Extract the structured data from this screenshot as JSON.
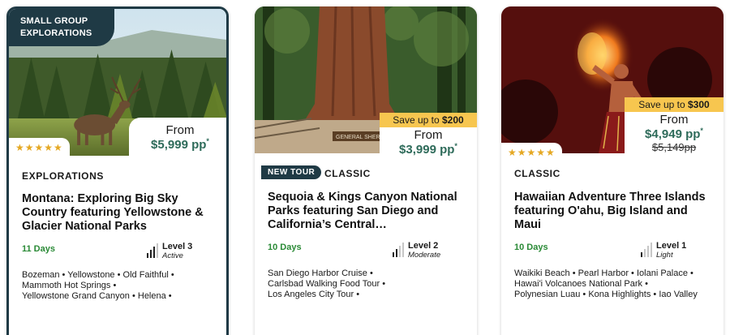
{
  "cards": [
    {
      "group_tag": "SMALL GROUP\nEXPLORATIONS",
      "rating": "★★★★★",
      "from": "From",
      "price": "$5,999 pp",
      "price_mark": "*",
      "type": "EXPLORATIONS",
      "title": "Montana: Exploring Big Sky Country featuring Yellowstone & Glacier National Parks",
      "days": "11 Days",
      "level": "Level 3",
      "level_sub": "Active",
      "level_value": 3,
      "highlights": [
        [
          "Bozeman",
          "Yellowstone",
          "Old Faithful"
        ],
        [
          "Mammoth Hot Springs"
        ],
        [
          "Yellowstone Grand Canyon",
          "Helena"
        ]
      ]
    },
    {
      "save": "Save up to",
      "save_amount": "$200",
      "from": "From",
      "price": "$3,999 pp",
      "price_mark": "*",
      "new_tour": "NEW TOUR",
      "type": "CLASSIC",
      "title": "Sequoia & Kings Canyon National Parks featuring San Diego and California’s Central…",
      "days": "10 Days",
      "level": "Level 2",
      "level_sub": "Moderate",
      "level_value": 2,
      "sign_text": "GENERAL SHERMAN",
      "highlights": [
        [
          "San Diego Harbor Cruise"
        ],
        [
          "Carlsbad Walking Food Tour"
        ],
        [
          "Los Angeles City Tour"
        ]
      ]
    },
    {
      "save": "Save up to",
      "save_amount": "$300",
      "rating": "★★★★★",
      "from": "From",
      "price": "$4,949 pp",
      "price_mark": "*",
      "old_price": "$5,149pp",
      "type": "CLASSIC",
      "title": "Hawaiian Adventure Three Islands featuring O'ahu, Big Island and Maui",
      "days": "10 Days",
      "level": "Level 1",
      "level_sub": "Light",
      "level_value": 1,
      "highlights": [
        [
          "Waikiki Beach",
          "Pearl Harbor",
          "Iolani Palace"
        ],
        [
          "Hawai'i Volcanoes National Park"
        ],
        [
          "Polynesian Luau",
          "Kona Highlights",
          "Iao Valley"
        ]
      ]
    }
  ],
  "colors": {
    "brand_dark": "#1f3a45",
    "price_green": "#2e6b5a",
    "days_green": "#2a8a36",
    "save_yellow": "#f7c64f",
    "star_gold": "#e5a823"
  }
}
